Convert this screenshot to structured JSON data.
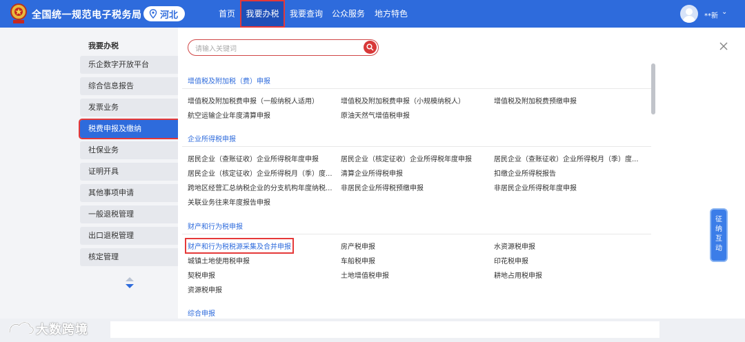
{
  "header": {
    "site_title": "全国统一规范电子税务局",
    "region": "河北",
    "nav": [
      {
        "label": "首页"
      },
      {
        "label": "我要办税"
      },
      {
        "label": "我要查询"
      },
      {
        "label": "公众服务"
      },
      {
        "label": "地方特色"
      }
    ],
    "user_name": "**新",
    "user_chevron": "⌄"
  },
  "sidebar": {
    "title": "我要办税",
    "items": [
      {
        "label": "乐企数字开放平台"
      },
      {
        "label": "综合信息报告"
      },
      {
        "label": "发票业务"
      },
      {
        "label": "税费申报及缴纳"
      },
      {
        "label": "社保业务"
      },
      {
        "label": "证明开具"
      },
      {
        "label": "其他事项申请"
      },
      {
        "label": "一般退税管理"
      },
      {
        "label": "出口退税管理"
      },
      {
        "label": "核定管理"
      }
    ]
  },
  "search": {
    "placeholder": "请输入关键词"
  },
  "sections": [
    {
      "title": "增值税及附加税（费）申报",
      "links": [
        "增值税及附加税费申报（一般纳税人适用）",
        "增值税及附加税费申报（小规模纳税人）",
        "增值税及附加税费预缴申报",
        "航空运输企业年度清算申报",
        "原油天然气增值税申报"
      ]
    },
    {
      "title": "企业所得税申报",
      "links": [
        "居民企业（查账征收）企业所得税年度申报",
        "居民企业（核定征收）企业所得税年度申报",
        "居民企业（查账征收）企业所得税月（季）度...",
        "居民企业（核定征收）企业所得税月（季）度...",
        "清算企业所得税申报",
        "扣缴企业所得税报告",
        "跨地区经营汇总纳税企业的分支机构年度纳税...",
        "非居民企业所得税预缴申报",
        "非居民企业所得税年度申报",
        "关联业务往来年度报告申报"
      ]
    },
    {
      "title": "财产和行为税申报",
      "links": [
        "财产和行为税税源采集及合并申报",
        "房产税申报",
        "水资源税申报",
        "城镇土地使用税申报",
        "车船税申报",
        "印花税申报",
        "契税申报",
        "土地增值税申报",
        "耕地占用税申报",
        "资源税申报"
      ]
    },
    {
      "title": "综合申报"
    }
  ],
  "side_tab": {
    "label": "征纳互动"
  },
  "watermark": {
    "text": "大数跨境"
  },
  "colors": {
    "primary": "#2e6bdc",
    "highlight": "#e53838"
  }
}
